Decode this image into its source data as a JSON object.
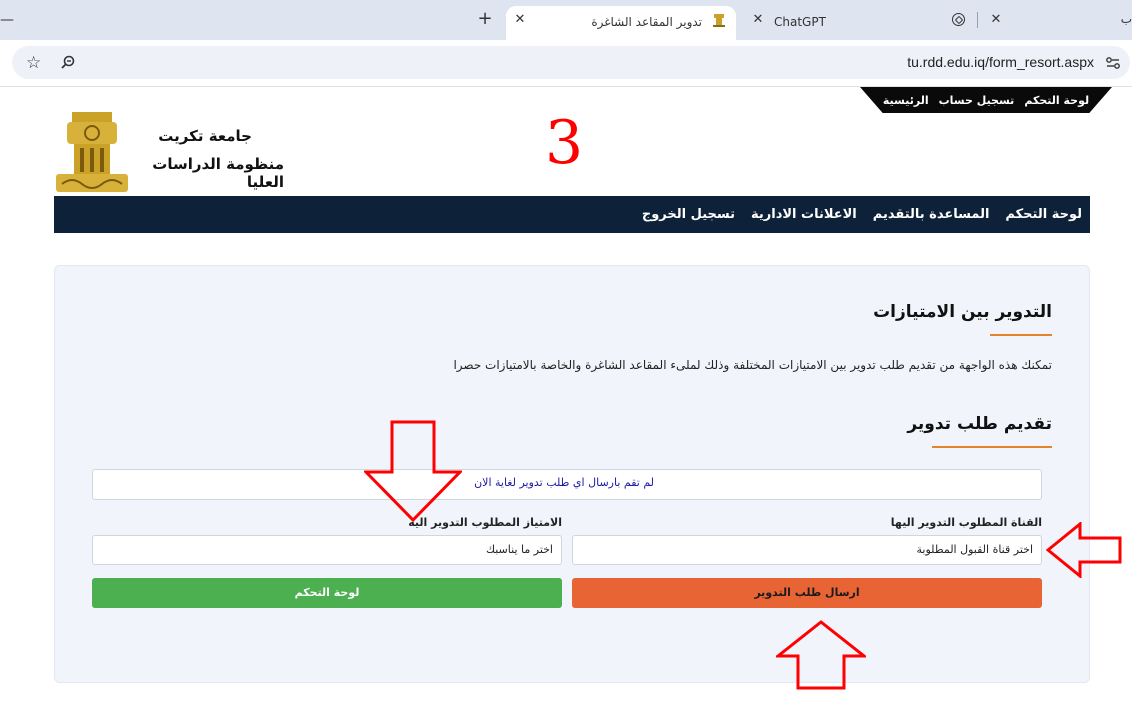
{
  "browser": {
    "partial_tab_label": "ب",
    "tabs": [
      {
        "title": "تدوير المقاعد الشاغرة",
        "active": true
      },
      {
        "title": "ChatGPT",
        "active": false
      }
    ],
    "new_tab_symbol": "+",
    "close_symbol": "✕",
    "minimize_symbol": "—",
    "url": "tu.rdd.edu.iq/form_resort.aspx"
  },
  "header": {
    "top_links": [
      "لوحة التحكم",
      "تسجيل حساب",
      "الرئيسية"
    ],
    "university_name": "جامعة تكريت",
    "system_name": "منظومة الدراسات العليا",
    "annotation_number": "3"
  },
  "nav": {
    "items": [
      "لوحة التحكم",
      "المساعدة بالتقديم",
      "الاعلانات الادارية",
      "تسجيل الخروج"
    ]
  },
  "content": {
    "section_title": "التدوير بين الامتيازات",
    "description": "تمكنك هذه الواجهة من تقديم طلب تدوير بين الامتيازات المختلفة وذلك لملىء المقاعد الشاغرة والخاصة بالامتيازات حصرا",
    "form_title": "تقديم طلب تدوير",
    "status_message": "لم تقم بارسال اي طلب تدوير لغاية الان",
    "channel_label": "القناة المطلوب التدوير اليها",
    "channel_value": "اختر قناة القبول المطلوبة",
    "privilege_label": "الامتياز المطلوب التدوير اليه",
    "privilege_value": "اختر ما يناسبك",
    "submit_label": "ارسال طلب التدوير",
    "dashboard_label": "لوحة التحكم"
  },
  "colors": {
    "nav_bg": "#0d2239",
    "accent_orange": "#e96434",
    "accent_green": "#4caf50",
    "underline": "#e4852c",
    "annotation_red": "#ff0000",
    "logo_gold": "#c9a227"
  },
  "icons": {
    "star": "star-icon",
    "zoom": "zoom-icon",
    "site_settings": "site-settings-icon",
    "chatgpt": "chatgpt-icon",
    "university_favicon": "university-favicon-icon"
  }
}
